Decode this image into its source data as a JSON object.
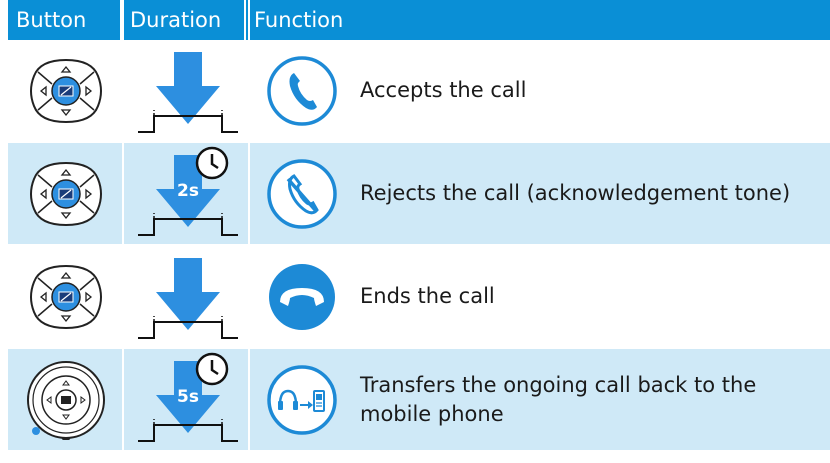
{
  "header": {
    "button": "Button",
    "duration": "Duration",
    "function": "Function"
  },
  "colors": {
    "header_bg": "#0a8fd6",
    "row_tint": "#cfe9f7",
    "arrow_blue": "#2d8fe0",
    "icon_blue": "#1d8ad6"
  },
  "rows": [
    {
      "button_icon": "dpad-button-icon",
      "duration_icon": "short-press-arrow-icon",
      "function_icon": "phone-accept-icon",
      "text": "Accepts the call"
    },
    {
      "button_icon": "dpad-button-icon",
      "duration_icon": "long-press-arrow-icon",
      "duration_label": "2s",
      "function_icon": "phone-reject-icon",
      "text": "Rejects the call (acknowledgement tone)"
    },
    {
      "button_icon": "dpad-button-icon",
      "duration_icon": "short-press-arrow-icon",
      "function_icon": "phone-hangup-icon",
      "text": "Ends the call"
    },
    {
      "button_icon": "speakerphone-button-icon",
      "duration_icon": "long-press-arrow-icon",
      "duration_label": "5s",
      "function_icon": "transfer-to-phone-icon",
      "text": "Transfers the ongoing call back to the mobile phone"
    }
  ]
}
